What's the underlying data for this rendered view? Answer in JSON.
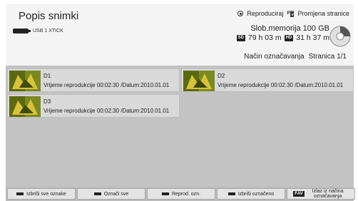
{
  "header": {
    "title": "Popis snimki",
    "usb_label": "USB 1 XTICK",
    "legend_play": "Reproduciraj",
    "legend_page_key": "P",
    "legend_page": "Promjena stranice",
    "memory": "Slob.memorija 100 GB",
    "sd_tag": "SD",
    "sd_time": "79 h 03 m",
    "hd_tag": "HD",
    "hd_time": "31 h 37 m",
    "mode": "Način označavanja",
    "page": "Stranica 1/1"
  },
  "items": [
    {
      "name": "D1",
      "info": "Vrijeme reprodukcije 00:02:30 /Datum:2010.01.01"
    },
    {
      "name": "D2",
      "info": "Vrijeme reprodukcije 00:02:30 /Datum:2010.01.01"
    },
    {
      "name": "D3",
      "info": "Vrijeme reprodukcije 00:02:30 /Datum:2010.01.01"
    }
  ],
  "footer": {
    "btn1": "Izbriši sve oznake",
    "btn2": "Označi sve",
    "btn3": "Reprod. ozn.",
    "btn4": "Izbriši označeno",
    "fav_key": "FAV",
    "btn5": "Izlaz iz načina označavanja"
  },
  "colors": {
    "grid_bg": "#c3c3c3",
    "item_bg": "#d9d9d9",
    "red_key": "#c02020",
    "green_key": "#20a020",
    "yellow_key": "#d0b000",
    "blue_key": "#2040c0"
  }
}
